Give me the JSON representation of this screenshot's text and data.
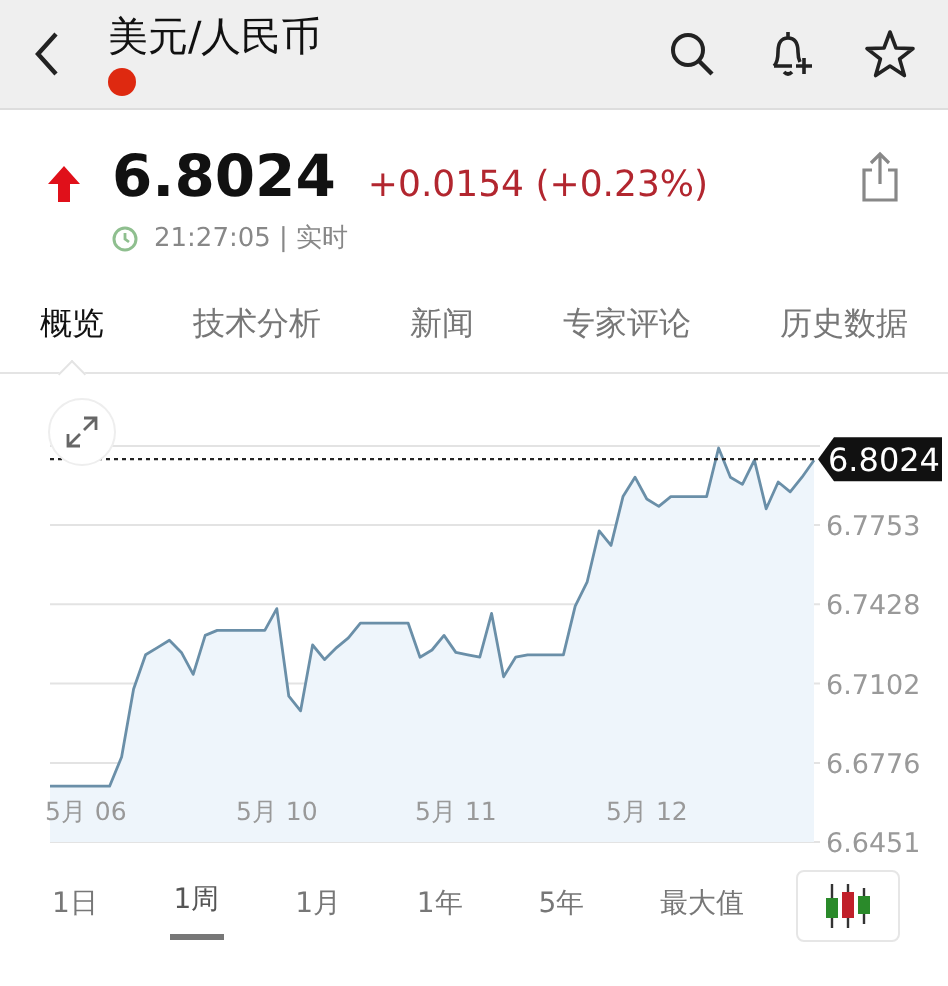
{
  "header": {
    "title": "美元/人民币"
  },
  "quote": {
    "price": "6.8024",
    "change": "+0.0154 (+0.23%)",
    "up": true,
    "time": "21:27:05 | 实时"
  },
  "tabs": [
    {
      "label": "概览",
      "selected": true
    },
    {
      "label": "技术分析",
      "selected": false
    },
    {
      "label": "新闻",
      "selected": false
    },
    {
      "label": "专家评论",
      "selected": false
    },
    {
      "label": "历史数据",
      "selected": false
    }
  ],
  "chart": {
    "chart_data": {
      "type": "area",
      "grid": true,
      "categories": [
        null,
        null,
        null,
        "5月 06",
        null,
        null,
        null,
        null,
        null,
        null,
        null,
        null,
        null,
        null,
        null,
        null,
        null,
        null,
        null,
        "5月 10",
        null,
        null,
        null,
        null,
        null,
        null,
        null,
        null,
        null,
        null,
        null,
        null,
        null,
        null,
        "5月 11",
        null,
        null,
        null,
        null,
        null,
        null,
        null,
        null,
        null,
        null,
        null,
        null,
        null,
        null,
        null,
        "5月 12",
        null,
        null,
        null,
        null,
        null,
        null,
        null,
        null,
        null,
        null,
        null,
        null,
        null,
        null
      ],
      "series": [
        {
          "color": "#6a8fa8",
          "values": [
            6.668,
            6.668,
            6.668,
            6.668,
            6.668,
            6.668,
            6.68,
            6.708,
            6.722,
            6.725,
            6.728,
            6.723,
            6.714,
            6.73,
            6.732,
            6.732,
            6.732,
            6.732,
            6.732,
            6.741,
            6.705,
            6.699,
            6.726,
            6.72,
            6.725,
            6.729,
            6.735,
            6.735,
            6.735,
            6.735,
            6.735,
            6.721,
            6.724,
            6.73,
            6.723,
            6.722,
            6.721,
            6.739,
            6.713,
            6.721,
            6.722,
            6.722,
            6.722,
            6.722,
            6.742,
            6.752,
            6.773,
            6.767,
            6.787,
            6.795,
            6.786,
            6.783,
            6.787,
            6.787,
            6.787,
            6.787,
            6.807,
            6.795,
            6.792,
            6.802,
            6.782,
            6.793,
            6.789,
            6.795,
            6.802
          ]
        }
      ],
      "ylim": [
        6.6451,
        6.8078
      ],
      "ref_lines": [
        {
          "axis": "y",
          "value": 6.8024,
          "label": "6.8024"
        }
      ],
      "yticks": [
        6.7753,
        6.7428,
        6.7102,
        6.6776,
        6.6451
      ]
    }
  },
  "ranges": [
    {
      "label": "1日",
      "selected": false
    },
    {
      "label": "1周",
      "selected": true
    },
    {
      "label": "1月",
      "selected": false
    },
    {
      "label": "1年",
      "selected": false
    },
    {
      "label": "5年",
      "selected": false
    },
    {
      "label": "最大值",
      "selected": false
    }
  ]
}
